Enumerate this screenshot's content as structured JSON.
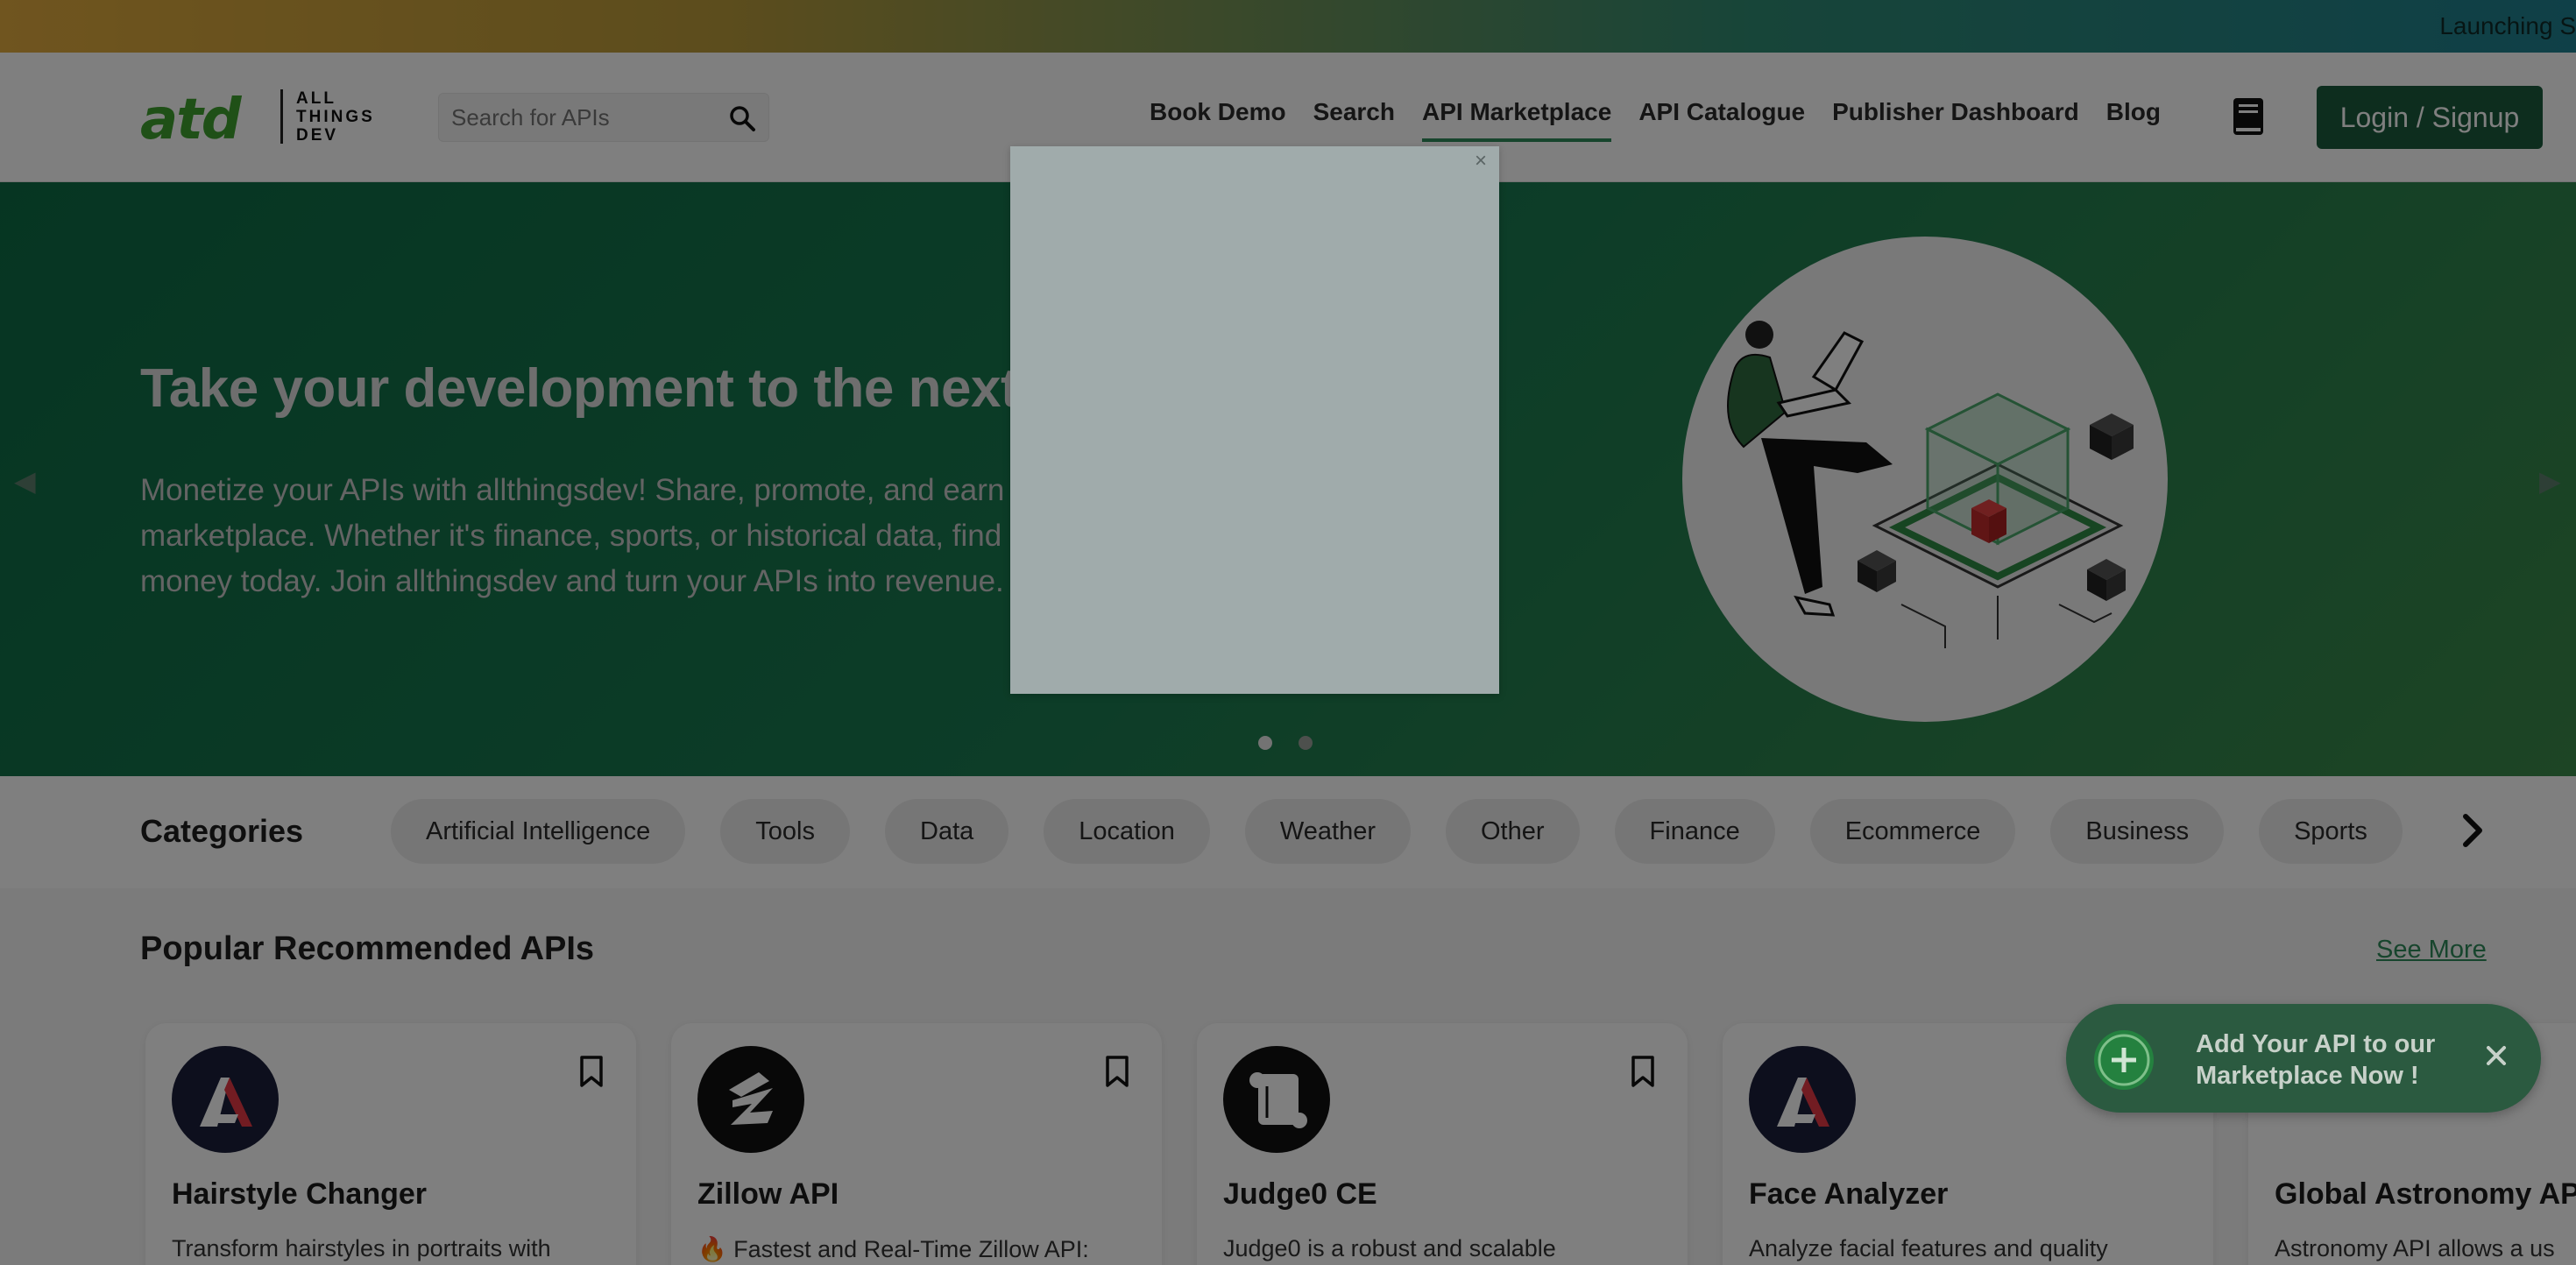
{
  "banner": {
    "text": "Launching S"
  },
  "header": {
    "logo": {
      "mark": "atd",
      "sub": "ALL THINGS DEV"
    },
    "search": {
      "placeholder": "Search for APIs"
    },
    "nav": [
      "Book Demo",
      "Search",
      "API Marketplace",
      "API Catalogue",
      "Publisher Dashboard",
      "Blog"
    ],
    "login_label": "Login / Signup"
  },
  "hero": {
    "title": "Take your development to the next level",
    "description": "Monetize your APIs with allthingsdev! Share, promote, and earn from your creations on our global marketplace. Whether it's finance, sports, or historical data, find your audience and start making money today. Join allthingsdev and turn your APIs into revenue."
  },
  "categories": {
    "title": "Categories",
    "items": [
      "Artificial Intelligence",
      "Tools",
      "Data",
      "Location",
      "Weather",
      "Other",
      "Finance",
      "Ecommerce",
      "Business",
      "Sports"
    ]
  },
  "popular": {
    "title": "Popular Recommended APIs",
    "see_more": "See More",
    "cards": [
      {
        "title": "Hairstyle Changer",
        "desc": "Transform hairstyles in portraits with"
      },
      {
        "title": "Zillow API",
        "desc": "🔥 Fastest and Real-Time Zillow API:"
      },
      {
        "title": "Judge0 CE",
        "desc": "Judge0 is a robust and scalable"
      },
      {
        "title": "Face Analyzer",
        "desc": "Analyze facial features and quality"
      },
      {
        "title": "Global Astronomy API",
        "desc": "Astronomy API allows a us"
      }
    ]
  },
  "modal": {
    "close": "×"
  },
  "fab": {
    "text": "Add Your API to our Marketplace Now !"
  },
  "colors": {
    "brand": "#1a5a3c",
    "accent": "#2f8a5a",
    "hero": "#0d6b45"
  }
}
